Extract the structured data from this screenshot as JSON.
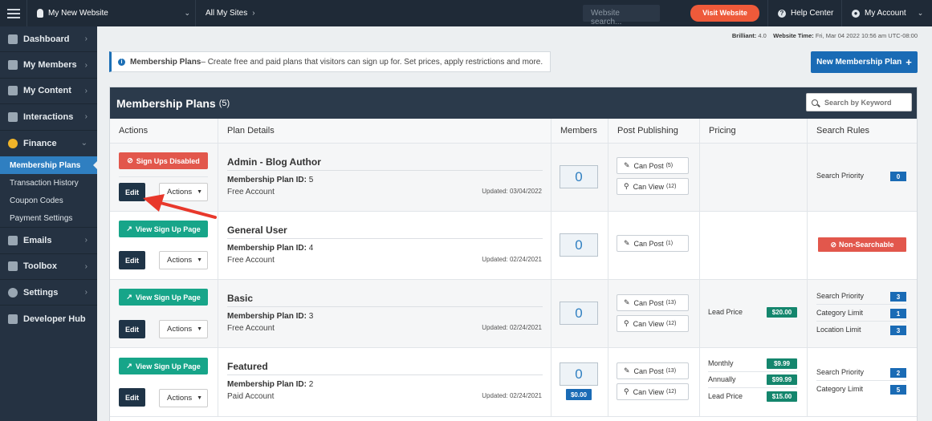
{
  "topbar": {
    "site_name": "My New Website",
    "all_sites": "All My Sites",
    "search_placeholder": "Website search...",
    "visit_button": "Visit Website",
    "help_center": "Help Center",
    "my_account": "My Account"
  },
  "meta": {
    "brilliant_label": "Brilliant:",
    "brilliant_value": "4.0",
    "time_label": "Website Time:",
    "time_value": "Fri, Mar 04 2022 10:56 am UTC-08:00"
  },
  "sidebar": {
    "items": [
      {
        "label": "Dashboard",
        "icon": "speedometer-icon"
      },
      {
        "label": "My Members",
        "icon": "users-icon"
      },
      {
        "label": "My Content",
        "icon": "folder-icon"
      },
      {
        "label": "Interactions",
        "icon": "chat-icon"
      },
      {
        "label": "Finance",
        "icon": "pie-chart-icon"
      },
      {
        "label": "Emails",
        "icon": "inbox-icon"
      },
      {
        "label": "Toolbox",
        "icon": "wrench-icon"
      },
      {
        "label": "Settings",
        "icon": "gear-icon"
      },
      {
        "label": "Developer Hub",
        "icon": "grid-icon"
      }
    ],
    "finance_sub": [
      "Membership Plans",
      "Transaction History",
      "Coupon Codes",
      "Payment Settings"
    ]
  },
  "info": {
    "title": "Membership Plans",
    "text": " – Create free and paid plans that visitors can sign up for. Set prices, apply restrictions and more."
  },
  "new_plan_button": "New Membership Plan",
  "panel": {
    "title": "Membership Plans",
    "count": "(5)",
    "search_placeholder": "Search by Keyword",
    "columns": [
      "Actions",
      "Plan Details",
      "Members",
      "Post Publishing",
      "Pricing",
      "Search Rules"
    ]
  },
  "labels": {
    "edit": "Edit",
    "actions": "Actions",
    "plan_id": "Membership Plan ID:",
    "can_post": "Can Post",
    "can_view": "Can View",
    "signups_disabled": "Sign Ups Disabled",
    "view_signup": "View Sign Up Page",
    "non_searchable": "Non-Searchable"
  },
  "plans": [
    {
      "name": "Admin - Blog Author",
      "id": "5",
      "type": "Free Account",
      "updated": "Updated: 03/04/2022",
      "members": "0",
      "can_post": "(5)",
      "can_view": "(12)",
      "search_priority": "0"
    },
    {
      "name": "General User",
      "id": "4",
      "type": "Free Account",
      "updated": "Updated: 02/24/2021",
      "members": "0",
      "can_post": "(1)"
    },
    {
      "name": "Basic",
      "id": "3",
      "type": "Free Account",
      "updated": "Updated: 02/24/2021",
      "members": "0",
      "can_post": "(13)",
      "can_view": "(12)",
      "pricing": [
        {
          "label": "Lead Price",
          "value": "$20.00"
        }
      ],
      "rules": [
        {
          "label": "Search Priority",
          "value": "3"
        },
        {
          "label": "Category Limit",
          "value": "1"
        },
        {
          "label": "Location Limit",
          "value": "3"
        }
      ]
    },
    {
      "name": "Featured",
      "id": "2",
      "type": "Paid Account",
      "updated": "Updated: 02/24/2021",
      "members": "0",
      "member_revenue": "$0.00",
      "can_post": "(13)",
      "can_view": "(12)",
      "pricing": [
        {
          "label": "Monthly",
          "value": "$9.99"
        },
        {
          "label": "Annually",
          "value": "$99.99"
        },
        {
          "label": "Lead Price",
          "value": "$15.00"
        }
      ],
      "rules": [
        {
          "label": "Search Priority",
          "value": "2"
        },
        {
          "label": "Category Limit",
          "value": "5"
        }
      ]
    }
  ],
  "colors": {
    "accent": "#1a6bb5",
    "danger": "#e2574c",
    "success": "#17a589",
    "annotation": "#e8382b"
  }
}
